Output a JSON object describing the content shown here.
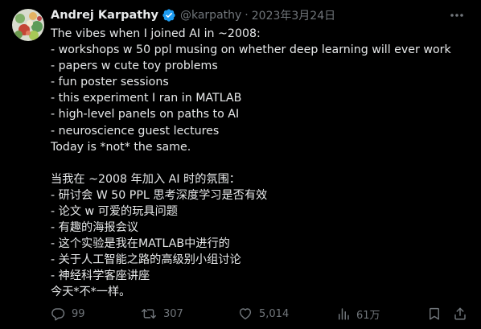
{
  "author": {
    "name": "Andrej Karpathy",
    "handle": "@karpathy",
    "separator": "·",
    "date": "2023年3月24日"
  },
  "tweet": {
    "english_lines": [
      "The vibes when I joined AI in ~2008:",
      "- workshops w 50 ppl musing on whether deep learning will ever work",
      "- papers w cute toy problems",
      "- fun poster sessions",
      "- this experiment I ran in MATLAB",
      "- high-level panels on paths to AI",
      "- neuroscience guest lectures",
      "Today is *not* the same."
    ],
    "chinese_lines": [
      "当我在 ~2008 年加入 AI 时的氛围：",
      "- 研讨会 W 50 PPL 思考深度学习是否有效",
      "- 论文 w 可爱的玩具问题",
      "- 有趣的海报会议",
      "- 这个实验是我在MATLAB中进行的",
      "- 关于人工智能之路的高级别小组讨论",
      "- 神经科学客座讲座",
      "今天*不*一样。"
    ]
  },
  "actions": {
    "replies": "99",
    "retweets": "307",
    "likes": "5,014",
    "views": "61万"
  },
  "icons": {
    "verified": "verified-badge-icon",
    "more": "more-options-icon",
    "reply": "reply-icon",
    "retweet": "retweet-icon",
    "like": "heart-icon",
    "views": "views-chart-icon",
    "bookmark": "bookmark-icon",
    "share": "share-icon"
  },
  "colors": {
    "background": "#000000",
    "text": "#e7e9ea",
    "secondary": "#71767b",
    "verified": "#1d9bf0"
  }
}
